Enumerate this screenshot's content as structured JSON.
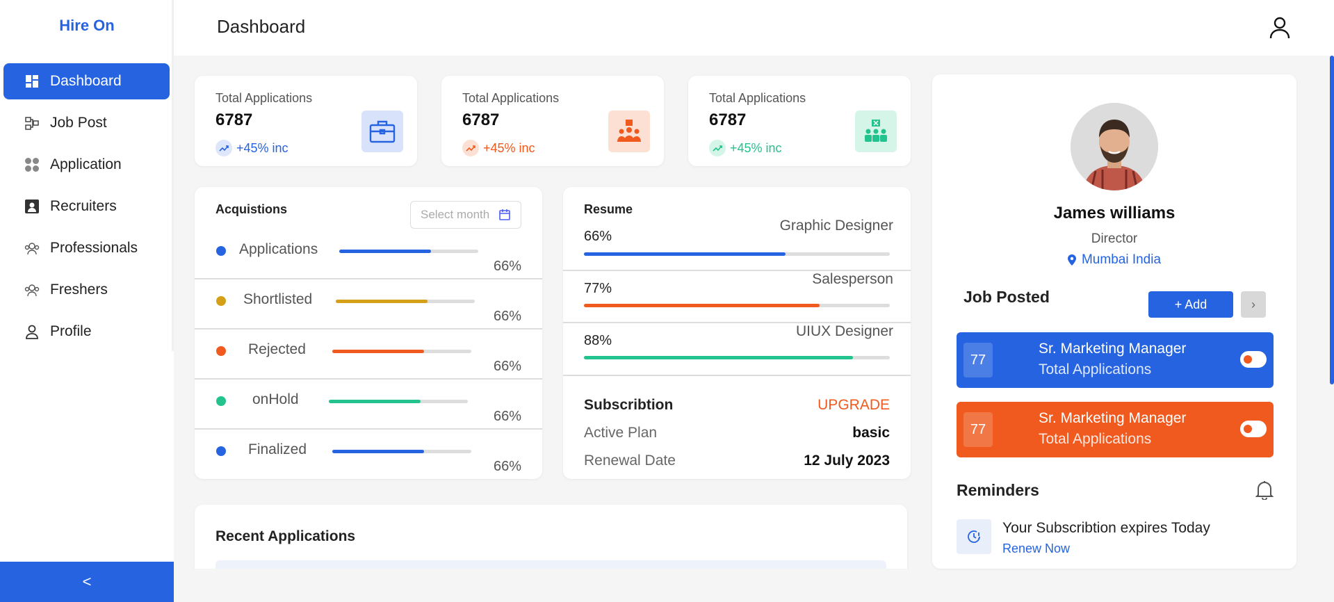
{
  "app": {
    "brand": "Hire On"
  },
  "sidebar": {
    "items": [
      {
        "label": "Dashboard",
        "icon": "dashboard-icon",
        "active": true
      },
      {
        "label": "Job Post",
        "icon": "job-post-icon"
      },
      {
        "label": "Application",
        "icon": "application-icon"
      },
      {
        "label": "Recruiters",
        "icon": "recruiters-icon"
      },
      {
        "label": "Professionals",
        "icon": "professionals-icon"
      },
      {
        "label": "Freshers",
        "icon": "freshers-icon"
      },
      {
        "label": "Profile",
        "icon": "profile-icon"
      }
    ],
    "collapse_label": "<"
  },
  "header": {
    "title": "Dashboard",
    "icon": "user-icon"
  },
  "stats": [
    {
      "label": "Total Applications",
      "value": "6787",
      "trend": "+45% inc",
      "color": "#2563e0",
      "icon": "briefcase-icon"
    },
    {
      "label": "Total Applications",
      "value": "6787",
      "trend": "+45% inc",
      "color": "#f05a1e",
      "icon": "team-icon"
    },
    {
      "label": "Total Applications",
      "value": "6787",
      "trend": "+45% inc",
      "color": "#22c38e",
      "icon": "group-rejected-icon"
    }
  ],
  "acquisitions": {
    "title": "Acquistions",
    "month_placeholder": "Select month",
    "rows": [
      {
        "name": "Applications",
        "pct": "66%",
        "progress": 0.66,
        "color": "#2563e0"
      },
      {
        "name": "Shortlisted",
        "pct": "66%",
        "progress": 0.66,
        "color": "#d4a017"
      },
      {
        "name": "Rejected",
        "pct": "66%",
        "progress": 0.66,
        "color": "#f05a1e"
      },
      {
        "name": "onHold",
        "pct": "66%",
        "progress": 0.66,
        "color": "#22c38e"
      },
      {
        "name": "Finalized",
        "pct": "66%",
        "progress": 0.66,
        "color": "#2563e0"
      }
    ]
  },
  "resume": {
    "title": "Resume",
    "rows": [
      {
        "role": "Graphic Designer",
        "pct": "66%",
        "progress": 0.66,
        "color": "#2563e0"
      },
      {
        "role": "Salesperson",
        "pct": "77%",
        "progress": 0.77,
        "color": "#f05a1e"
      },
      {
        "role": "UIUX Designer",
        "pct": "88%",
        "progress": 0.88,
        "color": "#22c38e"
      }
    ],
    "subscription": {
      "title": "Subscribtion",
      "upgrade": "UPGRADE",
      "plan_label": "Active Plan",
      "plan_value": "basic",
      "renewal_label": "Renewal Date",
      "renewal_value": "12 July 2023"
    }
  },
  "recent": {
    "title": "Recent Applications"
  },
  "profile": {
    "name": "James williams",
    "role": "Director",
    "location": "Mumbai India",
    "job_posted_title": "Job Posted",
    "add_label": "+ Add",
    "next_label": "›",
    "jobs": [
      {
        "count": "77",
        "title": "Sr. Marketing Manager",
        "subtitle": "Total Applications",
        "color": "#2563e0"
      },
      {
        "count": "77",
        "title": "Sr. Marketing Manager",
        "subtitle": "Total Applications",
        "color": "#f05a1e"
      }
    ],
    "reminders_title": "Reminders",
    "reminder_text": "Your Subscribtion expires Today",
    "reminder_link": "Renew Now"
  }
}
